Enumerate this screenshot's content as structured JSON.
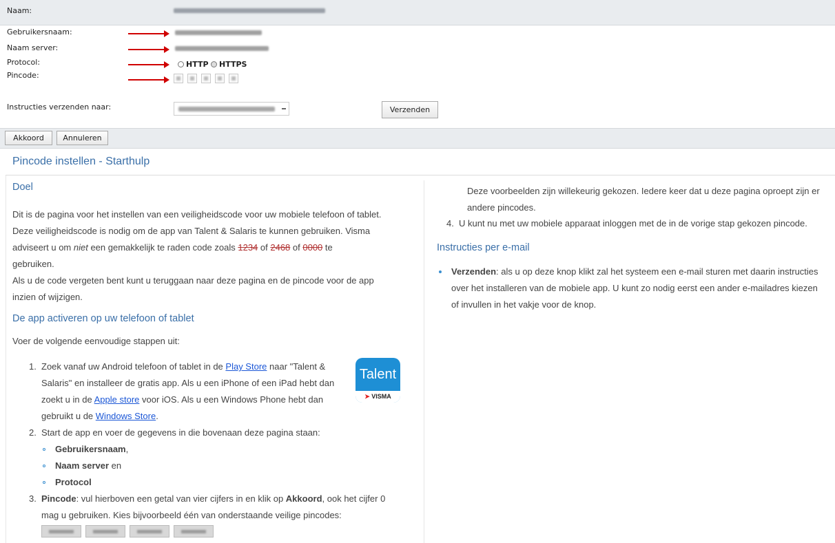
{
  "form": {
    "naam_label": "Naam:",
    "gebruikersnaam_label": "Gebruikersnaam:",
    "server_label": "Naam server:",
    "protocol_label": "Protocol:",
    "protocol_http": "HTTP",
    "protocol_https": "HTTPS",
    "pincode_label": "Pincode:",
    "instructies_label": "Instructies verzenden naar:",
    "verzenden_button": "Verzenden",
    "akkoord_button": "Akkoord",
    "annuleren_button": "Annuleren"
  },
  "help": {
    "title": "Pincode instellen - Starthulp",
    "doel_heading": "Doel",
    "doel_p1": "Dit is de pagina voor het instellen van een veiligheidscode voor uw mobiele telefoon of tablet.",
    "doel_p2a": "Deze veiligheidscode is nodig om de app van Talent & Salaris te kunnen gebruiken. Visma",
    "doel_p2b": "adviseert u om ",
    "doel_p2_niet": "niet",
    "doel_p2c": " een gemakkelijk te raden code zoals ",
    "code1": "1234",
    "of1": " of ",
    "code2": "2468",
    "of2": " of ",
    "code3": "0000",
    "te": " te",
    "gebruiken": "gebruiken.",
    "doel_p3a": "Als u de code vergeten bent kunt u teruggaan naar deze pagina en de pincode voor de app",
    "doel_p3b": "inzien of wijzigen.",
    "activeren_heading": "De app activeren op uw telefoon of tablet",
    "activeren_intro": "Voer de volgende eenvoudige stappen uit:",
    "step1_num": "1.",
    "step1_a": "Zoek vanaf uw Android telefoon of tablet in de ",
    "step1_playstore": "Play Store",
    "step1_b": " naar \"Talent &",
    "step1_c": "Salaris\" en installeer de gratis app. Als u een iPhone of een iPad hebt dan",
    "step1_d": "zoekt u in de ",
    "step1_applestore": "Apple store",
    "step1_e": " voor iOS. Als u een Windows Phone hebt dan",
    "step1_f": "gebruikt u de ",
    "step1_winstore": "Windows Store",
    "step1_g": ".",
    "step2_num": "2.",
    "step2": "Start de app en voer de gegevens in die bovenaan deze pagina staan:",
    "sub1_bold": "Gebruikersnaam",
    "sub1_rest": ",",
    "sub2_bold": "Naam server",
    "sub2_rest": " en",
    "sub3_bold": "Protocol",
    "step3_num": "3.",
    "step3_bold": "Pincode",
    "step3_a": ": vul hierboven een getal van vier cijfers in en klik op ",
    "step3_akkoord": "Akkoord",
    "step3_b": ", ook het cijfer 0",
    "step3_c": "mag u gebruiken. Kies bijvoorbeeld één van onderstaande veilige pincodes:",
    "right_p1a": "Deze voorbeelden zijn willekeurig gekozen. Iedere keer dat u deze pagina oproept zijn er",
    "right_p1b": "andere pincodes.",
    "step4_num": "4.",
    "step4": "U kunt nu met uw mobiele apparaat inloggen met de in de vorige stap gekozen pincode.",
    "email_heading": "Instructies per e-mail",
    "email_bold": "Verzenden",
    "email_a": ": als u op deze knop klikt zal het systeem een e-mail sturen met daarin instructies",
    "email_b": "over het installeren van de mobiele app. U kunt zo nodig eerst een ander e-mailadres kiezen",
    "email_c": "of invullen in het vakje voor de knop."
  },
  "logo": {
    "text": "Talent",
    "brand": "VISMA",
    "color": "#1e8fd5"
  }
}
